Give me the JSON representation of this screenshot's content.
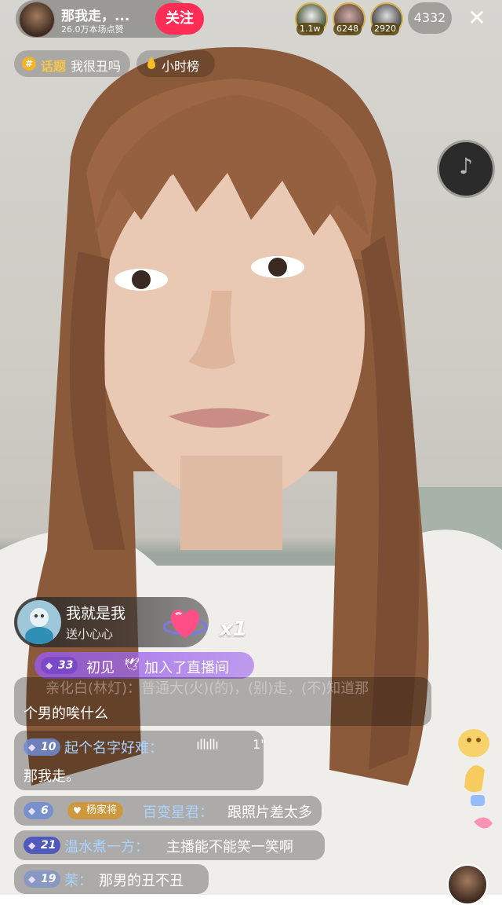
{
  "host": {
    "name": "那我走，...",
    "likes": "26.0万本场点赞",
    "follow_label": "关注"
  },
  "viewers": [
    {
      "badge": "1.1w",
      "color": "#3a4a2c"
    },
    {
      "badge": "6248",
      "color": "#5a4438"
    },
    {
      "badge": "2920",
      "color": "#3b3b40"
    }
  ],
  "viewer_count": "4332",
  "close_icon": "close-icon",
  "topic": {
    "tag": "话题",
    "text": "我很丑吗"
  },
  "rank": {
    "label": "小时榜"
  },
  "gift": {
    "user": "我就是我",
    "desc": "送小心心",
    "count": "x1"
  },
  "join": {
    "level": "33",
    "name": "初见",
    "text": "加入了直播间"
  },
  "chat": [
    {
      "faded": "亲化白(林灯)：普通大(火)(的)，(别)走，(不)知道那",
      "text": "个男的唉什么"
    },
    {
      "level": "10",
      "user": "起个名字好难：",
      "voice": "ıllıllı",
      "duration": "1\"",
      "text": "那我走。"
    },
    {
      "level": "6",
      "fan_badge": "杨家将",
      "user": "百变星君：",
      "text": "跟照片差太多"
    },
    {
      "level": "21",
      "user": "温水煮一方：",
      "text": "主播能不能笑一笑啊"
    },
    {
      "level": "19",
      "user": "茉：",
      "text": "那男的丑不丑"
    }
  ],
  "colors": {
    "follow": "#ff2c55",
    "username": "#a9d3ff",
    "topic_tag": "#f7c648",
    "join_bar": "#9a5ae6"
  }
}
